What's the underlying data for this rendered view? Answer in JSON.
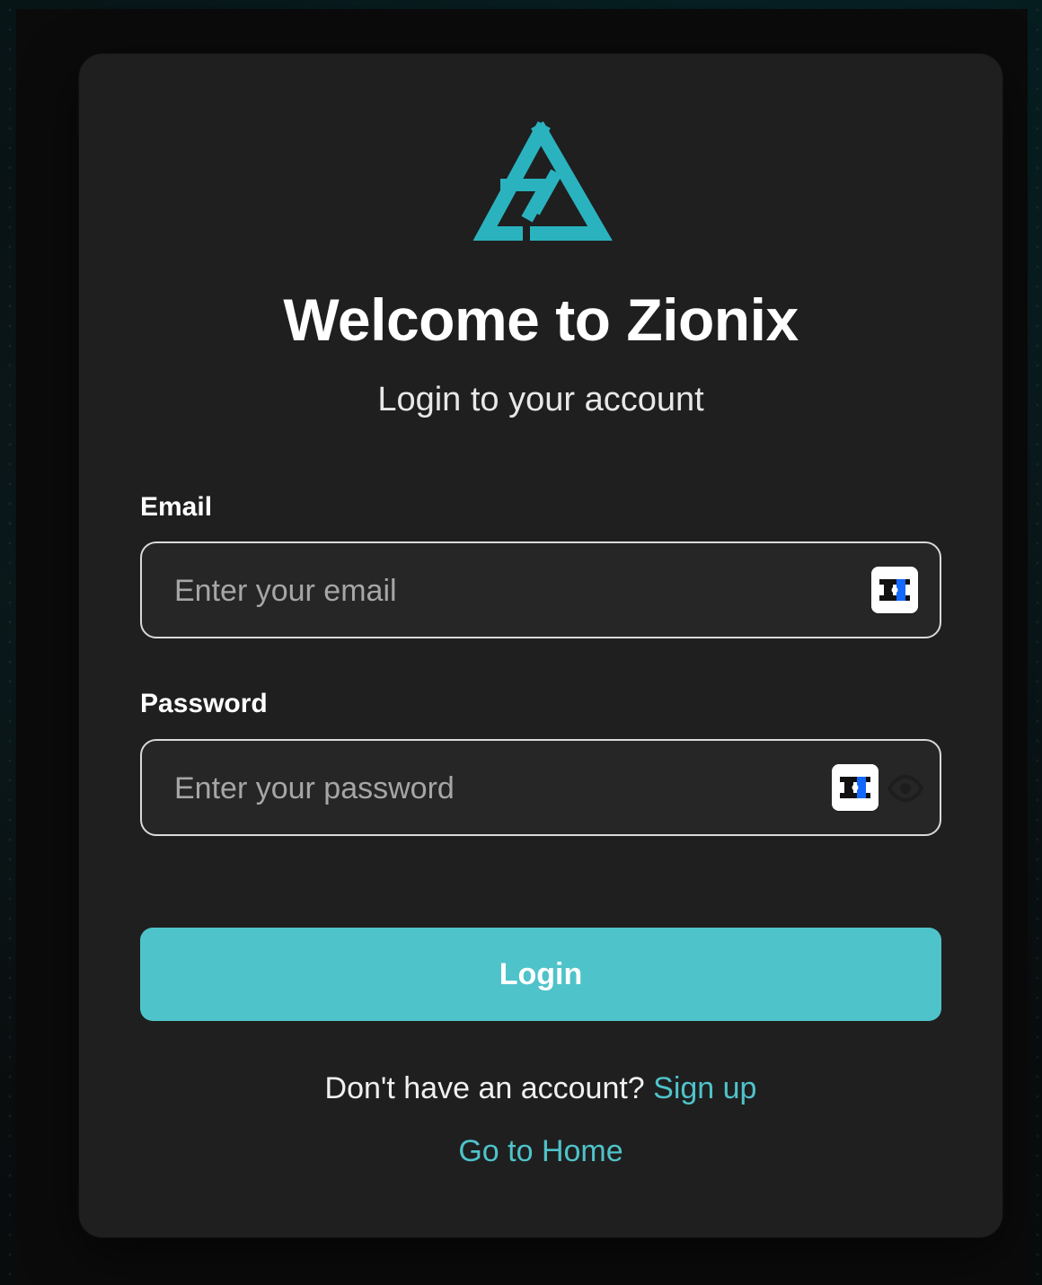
{
  "brand": {
    "accent_color": "#4FC3CA",
    "logo_icon": "zionix-triangle-logo-icon"
  },
  "header": {
    "title": "Welcome to Zionix",
    "subtitle": "Login to your account"
  },
  "form": {
    "email": {
      "label": "Email",
      "placeholder": "Enter your email",
      "value": "",
      "autofill_icon": "password-manager-icon"
    },
    "password": {
      "label": "Password",
      "placeholder": "Enter your password",
      "value": "",
      "autofill_icon": "password-manager-icon",
      "visibility_icon": "eye-icon"
    },
    "login_label": "Login"
  },
  "footer": {
    "signup_prompt": "Don't have an account?",
    "signup_label": "Sign up",
    "home_label": "Go to Home"
  }
}
